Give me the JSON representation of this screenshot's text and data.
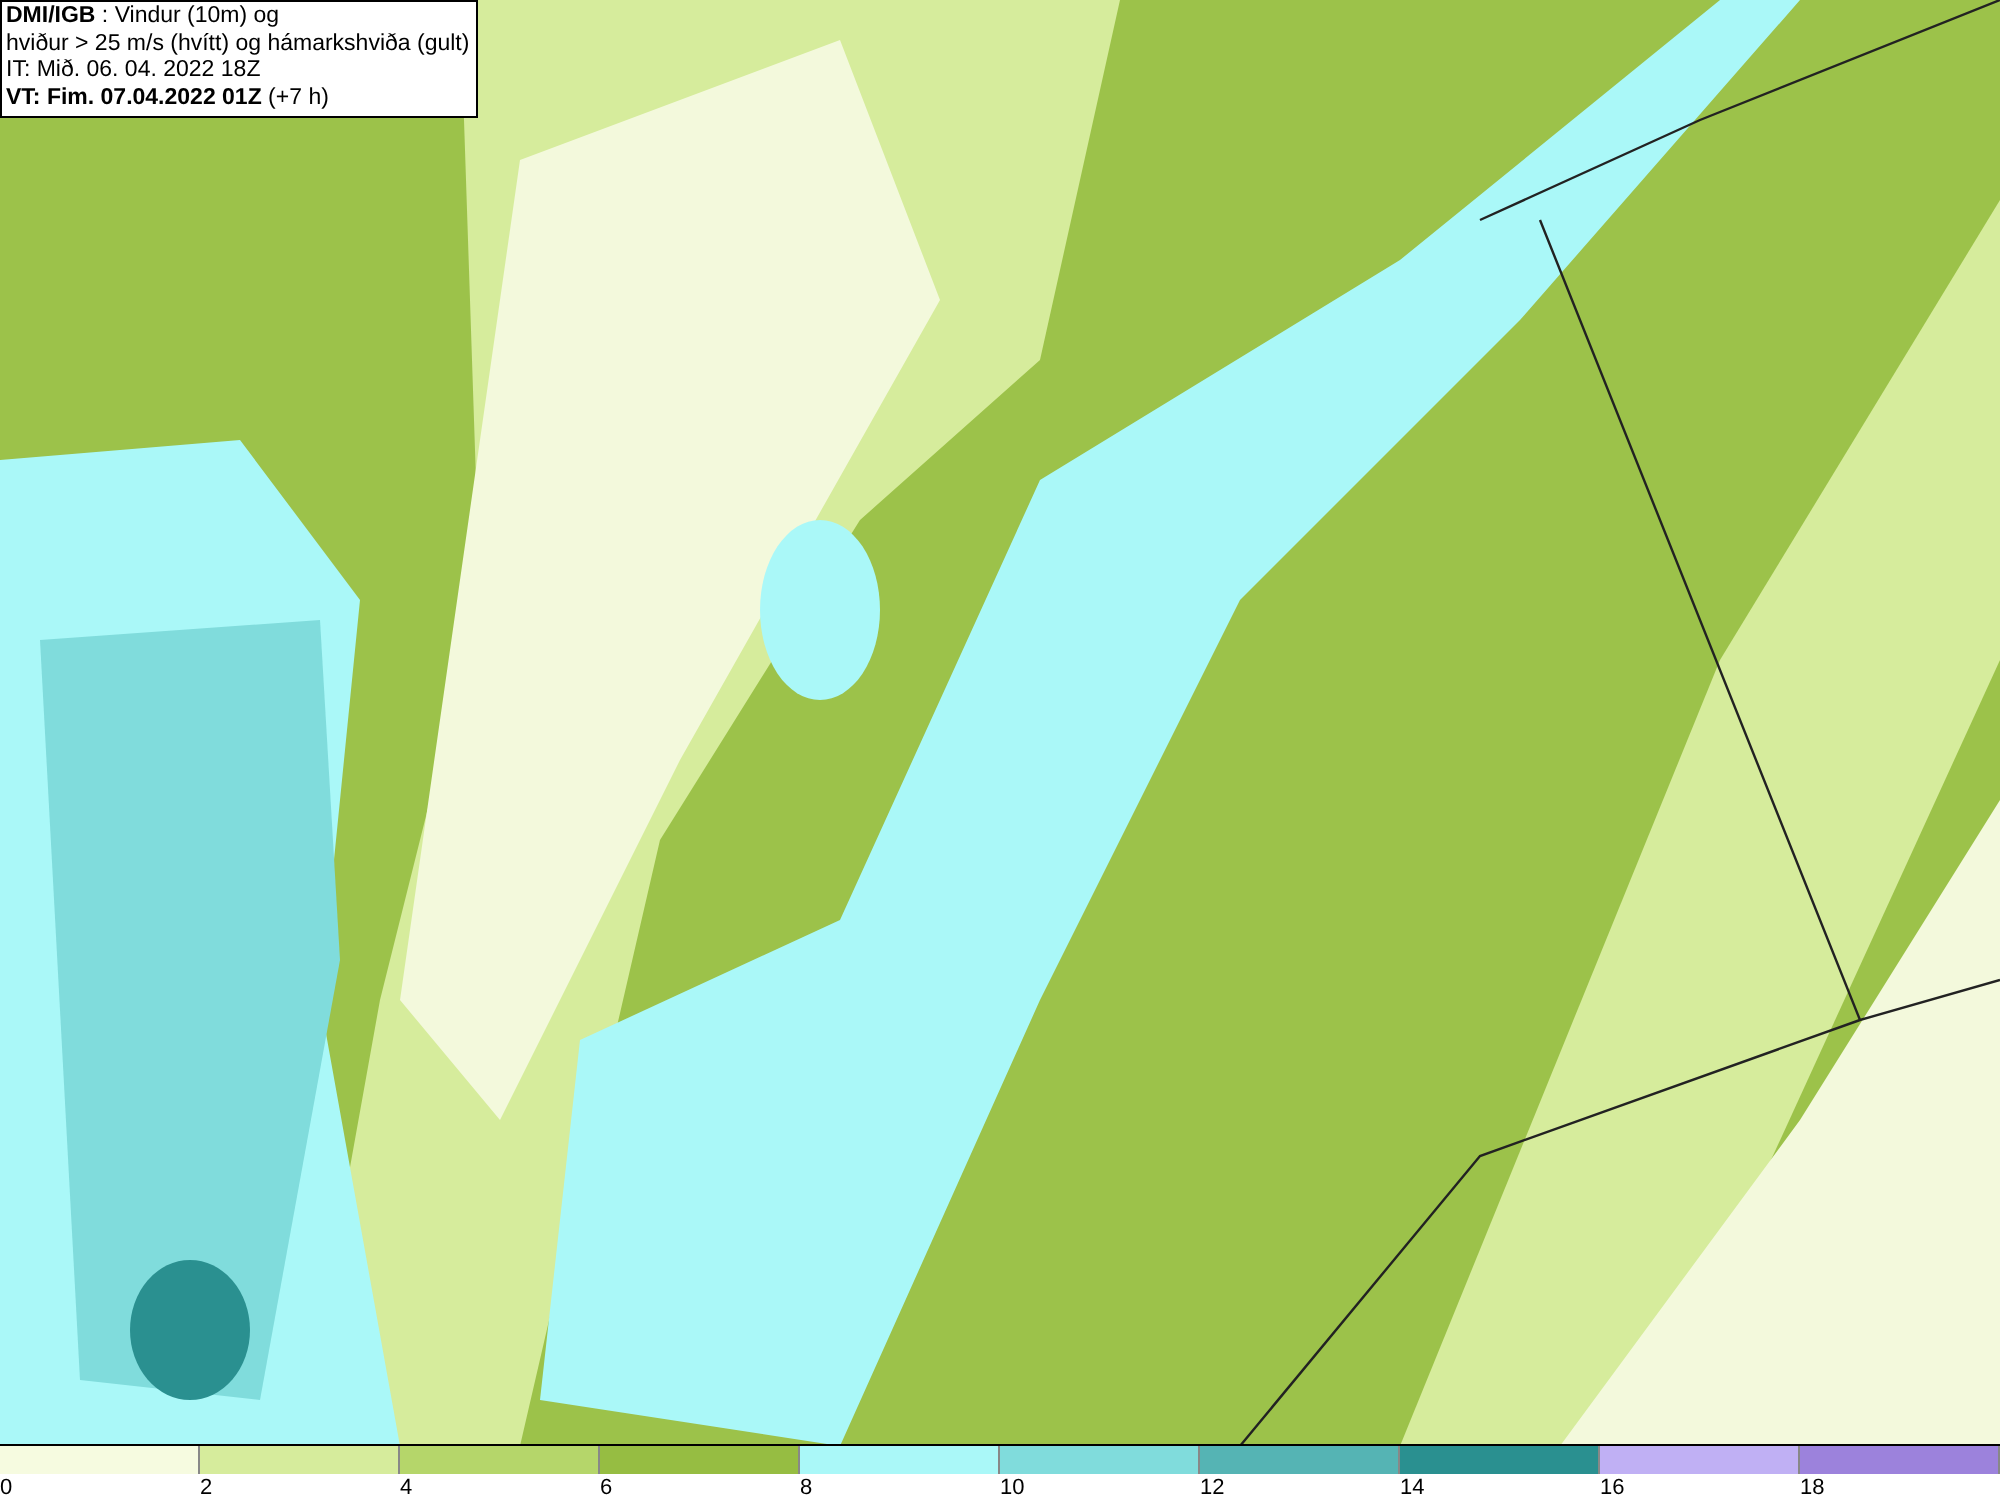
{
  "header": {
    "lines": [
      "**DMI/IGB** : Vindur (10m) og",
      "hviður > 25 m/s (hvítt) og hámarkshviða (gult)",
      "IT: Mið. 06. 04. 2022 18Z",
      "**VT: Fim. 07.04.2022 01Z** (+7 h)"
    ]
  },
  "legend": {
    "swatches": [
      {
        "label": "0",
        "color": "#f6fbe0"
      },
      {
        "label": "2",
        "color": "#d6ec9c"
      },
      {
        "label": "4",
        "color": "#b5d66a"
      },
      {
        "label": "6",
        "color": "#96bd42"
      },
      {
        "label": "8",
        "color": "#aaf8f8"
      },
      {
        "label": "10",
        "color": "#80dcdc"
      },
      {
        "label": "12",
        "color": "#55b4b4"
      },
      {
        "label": "14",
        "color": "#2a9090"
      },
      {
        "label": "16",
        "color": "#c0b0f4"
      },
      {
        "label": "18",
        "color": "#9c82dc"
      }
    ]
  }
}
